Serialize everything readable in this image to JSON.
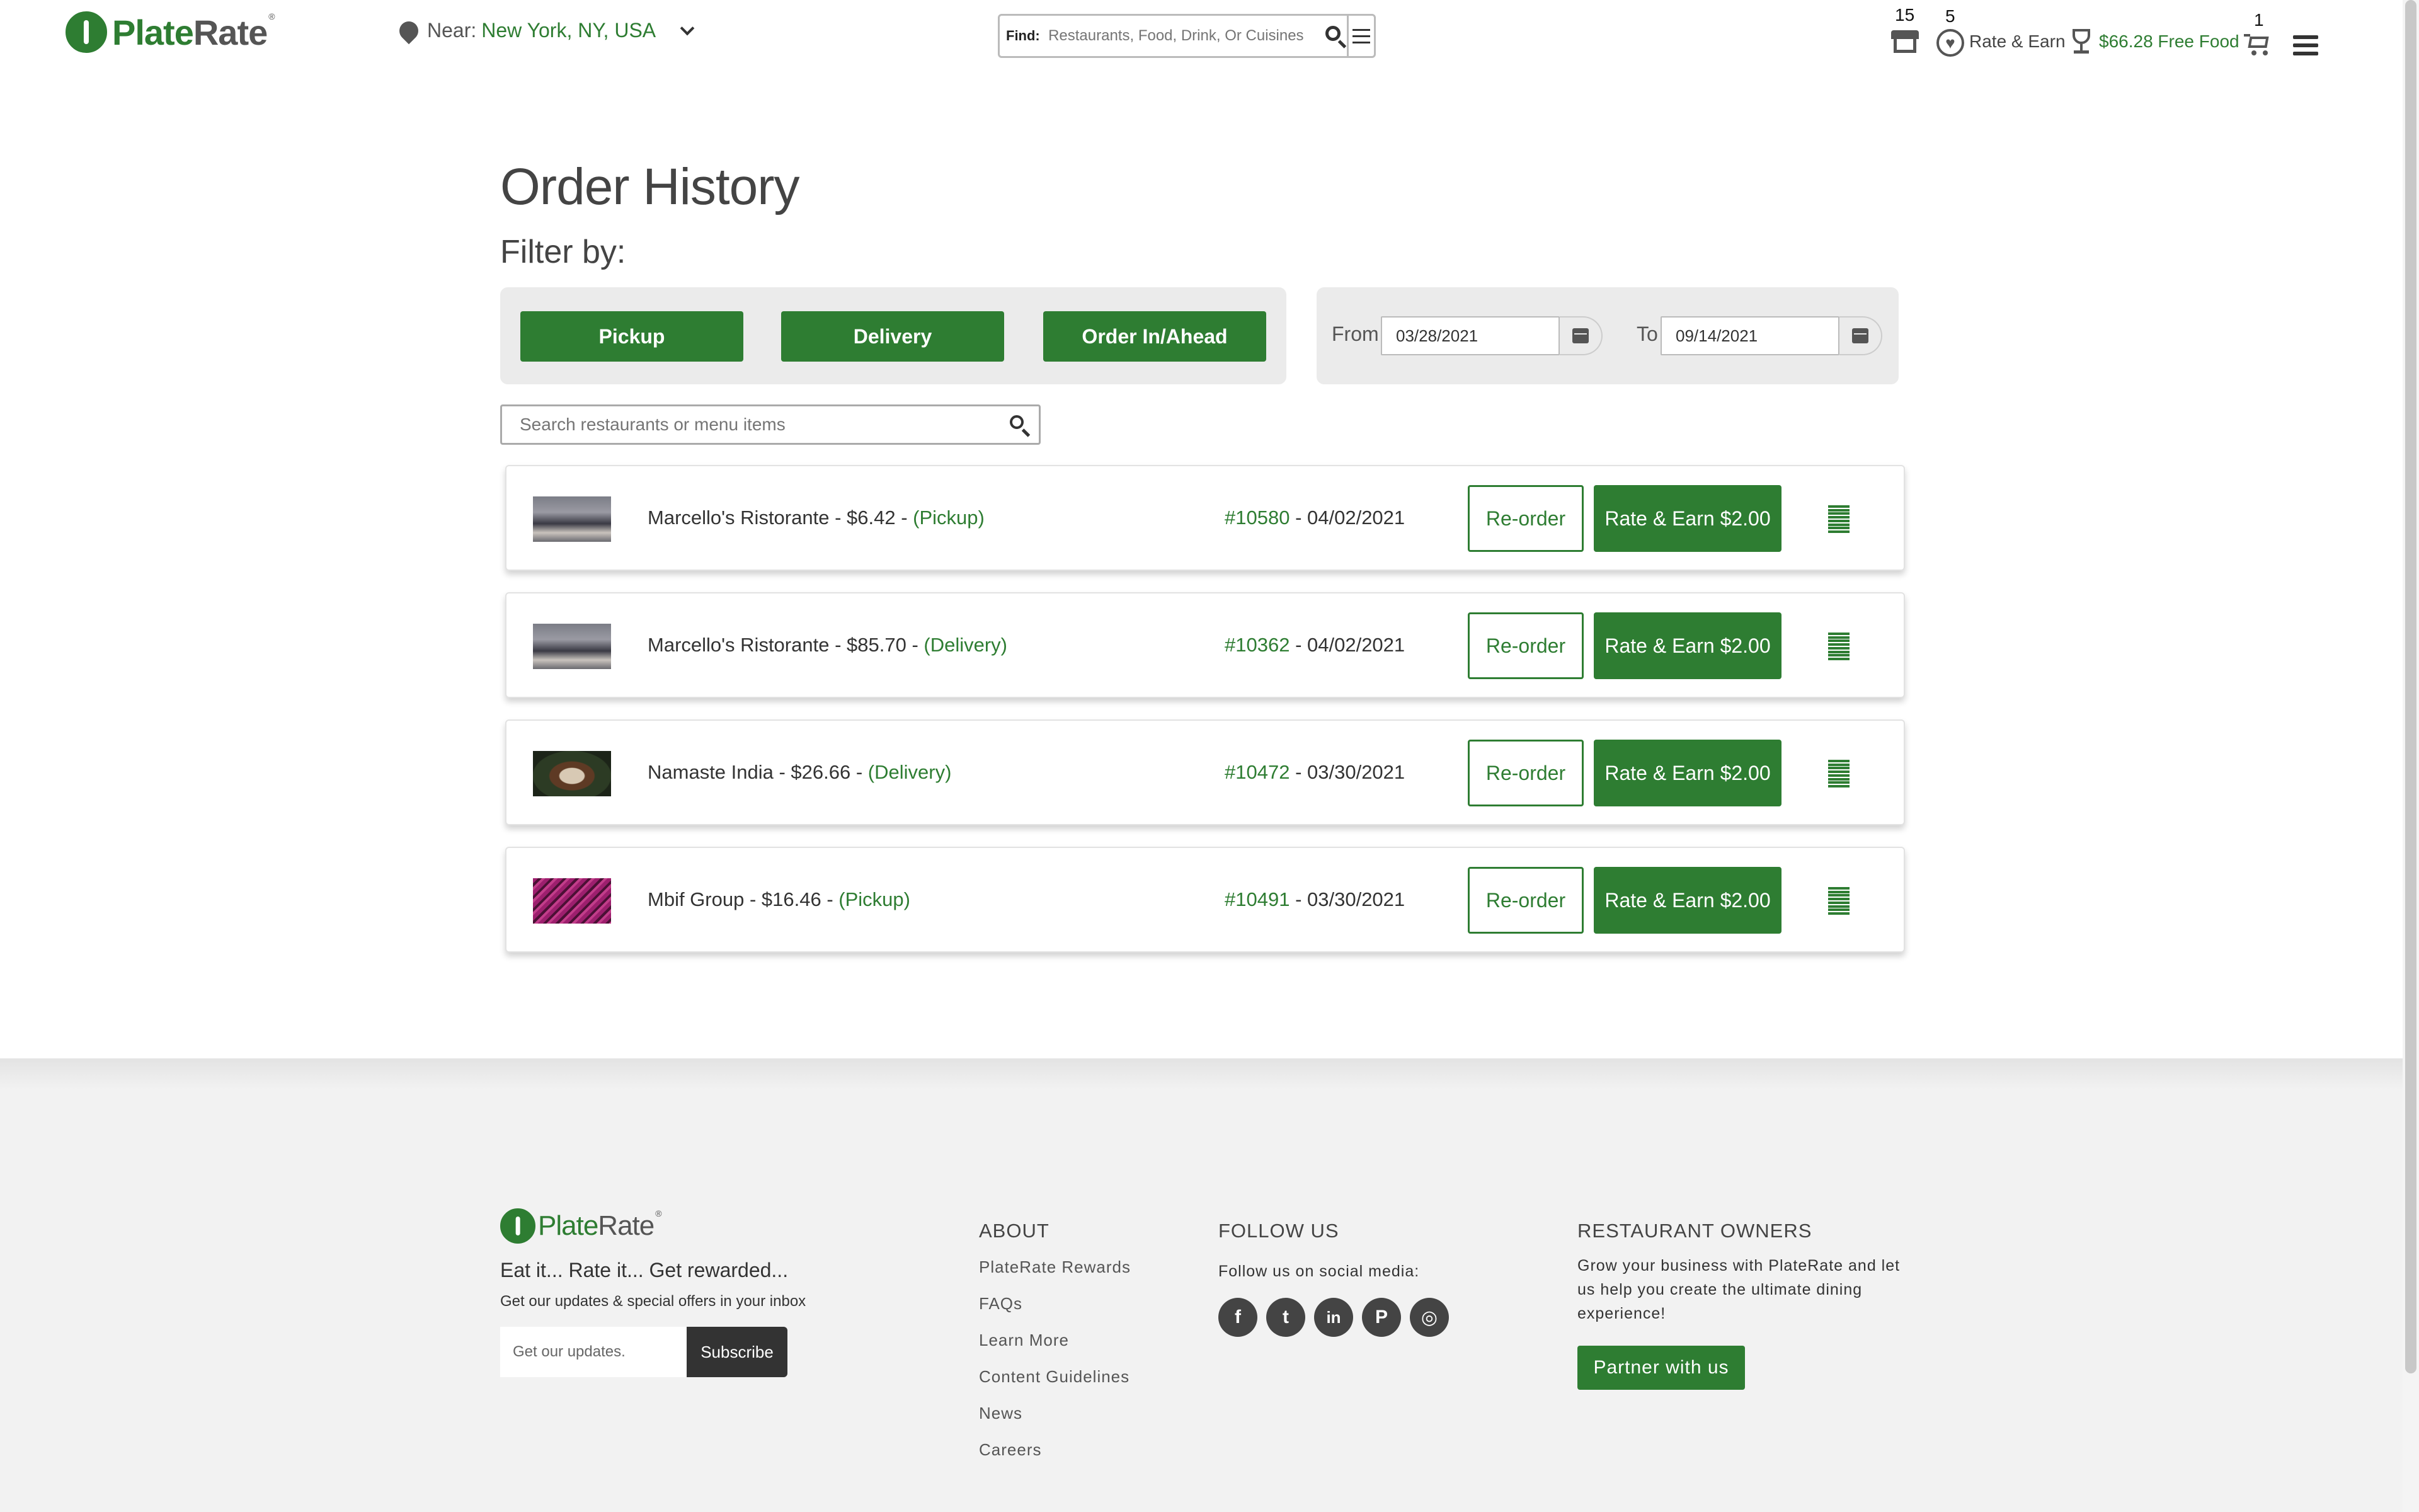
{
  "header": {
    "logo": {
      "part1": "Plate",
      "part2": "Rate",
      "reg": "®"
    },
    "near_label": "Near:",
    "near_value": "New York, NY, USA",
    "find_label": "Find:",
    "find_placeholder": "Restaurants, Food, Drink, Or Cuisines",
    "stores_count": "15",
    "rate_count": "5",
    "rate_earn_label": "Rate & Earn",
    "free_food_label": "$66.28 Free Food",
    "cart_count": "1",
    "icons": [
      "location-pin-icon",
      "chevron-down-icon",
      "search-icon",
      "filter-icon",
      "store-icon",
      "heart-icon",
      "trophy-icon",
      "cart-icon",
      "hamburger-menu-icon"
    ]
  },
  "main": {
    "title": "Order History",
    "filter_label": "Filter by:",
    "filters": [
      "Pickup",
      "Delivery",
      "Order In/Ahead"
    ],
    "date_from_label": "From",
    "date_from": "03/28/2021",
    "date_to_label": "To",
    "date_to": "09/14/2021",
    "search_placeholder": "Search restaurants or menu items",
    "orders": [
      {
        "name": "Marcello's Ristorante - $6.42 - ",
        "type": "(Pickup)",
        "number": "#10580",
        "date": " - 04/02/2021",
        "reorder": "Re-order",
        "rate": "Rate & Earn $2.00"
      },
      {
        "name": "Marcello's Ristorante - $85.70 - ",
        "type": "(Delivery)",
        "number": "#10362",
        "date": " - 04/02/2021",
        "reorder": "Re-order",
        "rate": "Rate & Earn $2.00"
      },
      {
        "name": "Namaste India - $26.66 - ",
        "type": "(Delivery)",
        "number": "#10472",
        "date": " - 03/30/2021",
        "reorder": "Re-order",
        "rate": "Rate & Earn $2.00"
      },
      {
        "name": "Mbif Group - $16.46 - ",
        "type": "(Pickup)",
        "number": "#10491",
        "date": " - 03/30/2021",
        "reorder": "Re-order",
        "rate": "Rate & Earn $2.00"
      }
    ]
  },
  "footer": {
    "logo": {
      "part1": "Plate",
      "part2": "Rate",
      "reg": "®"
    },
    "tagline": "Eat it... Rate it... Get rewarded...",
    "updates_text": "Get our updates & special offers in your inbox",
    "subscribe_placeholder": "Get our updates.",
    "subscribe_label": "Subscribe",
    "about_heading": "ABOUT",
    "about_links": [
      "PlateRate Rewards",
      "FAQs",
      "Learn More",
      "Content Guidelines",
      "News",
      "Careers"
    ],
    "follow_heading": "FOLLOW US",
    "follow_text": "Follow us on social media:",
    "social": [
      {
        "icon": "facebook-icon",
        "glyph": "f"
      },
      {
        "icon": "twitter-icon",
        "glyph": "t"
      },
      {
        "icon": "linkedin-icon",
        "glyph": "in"
      },
      {
        "icon": "pinterest-icon",
        "glyph": "P"
      },
      {
        "icon": "instagram-icon",
        "glyph": "◎"
      }
    ],
    "owners_heading": "RESTAURANT OWNERS",
    "owners_text": "Grow your business with PlateRate and let us help you create the ultimate dining experience!",
    "partner_label": "Partner with us"
  },
  "colors": {
    "accent": "#2e7d32",
    "panel": "#ebebeb",
    "footer": "#f2f2f2"
  }
}
